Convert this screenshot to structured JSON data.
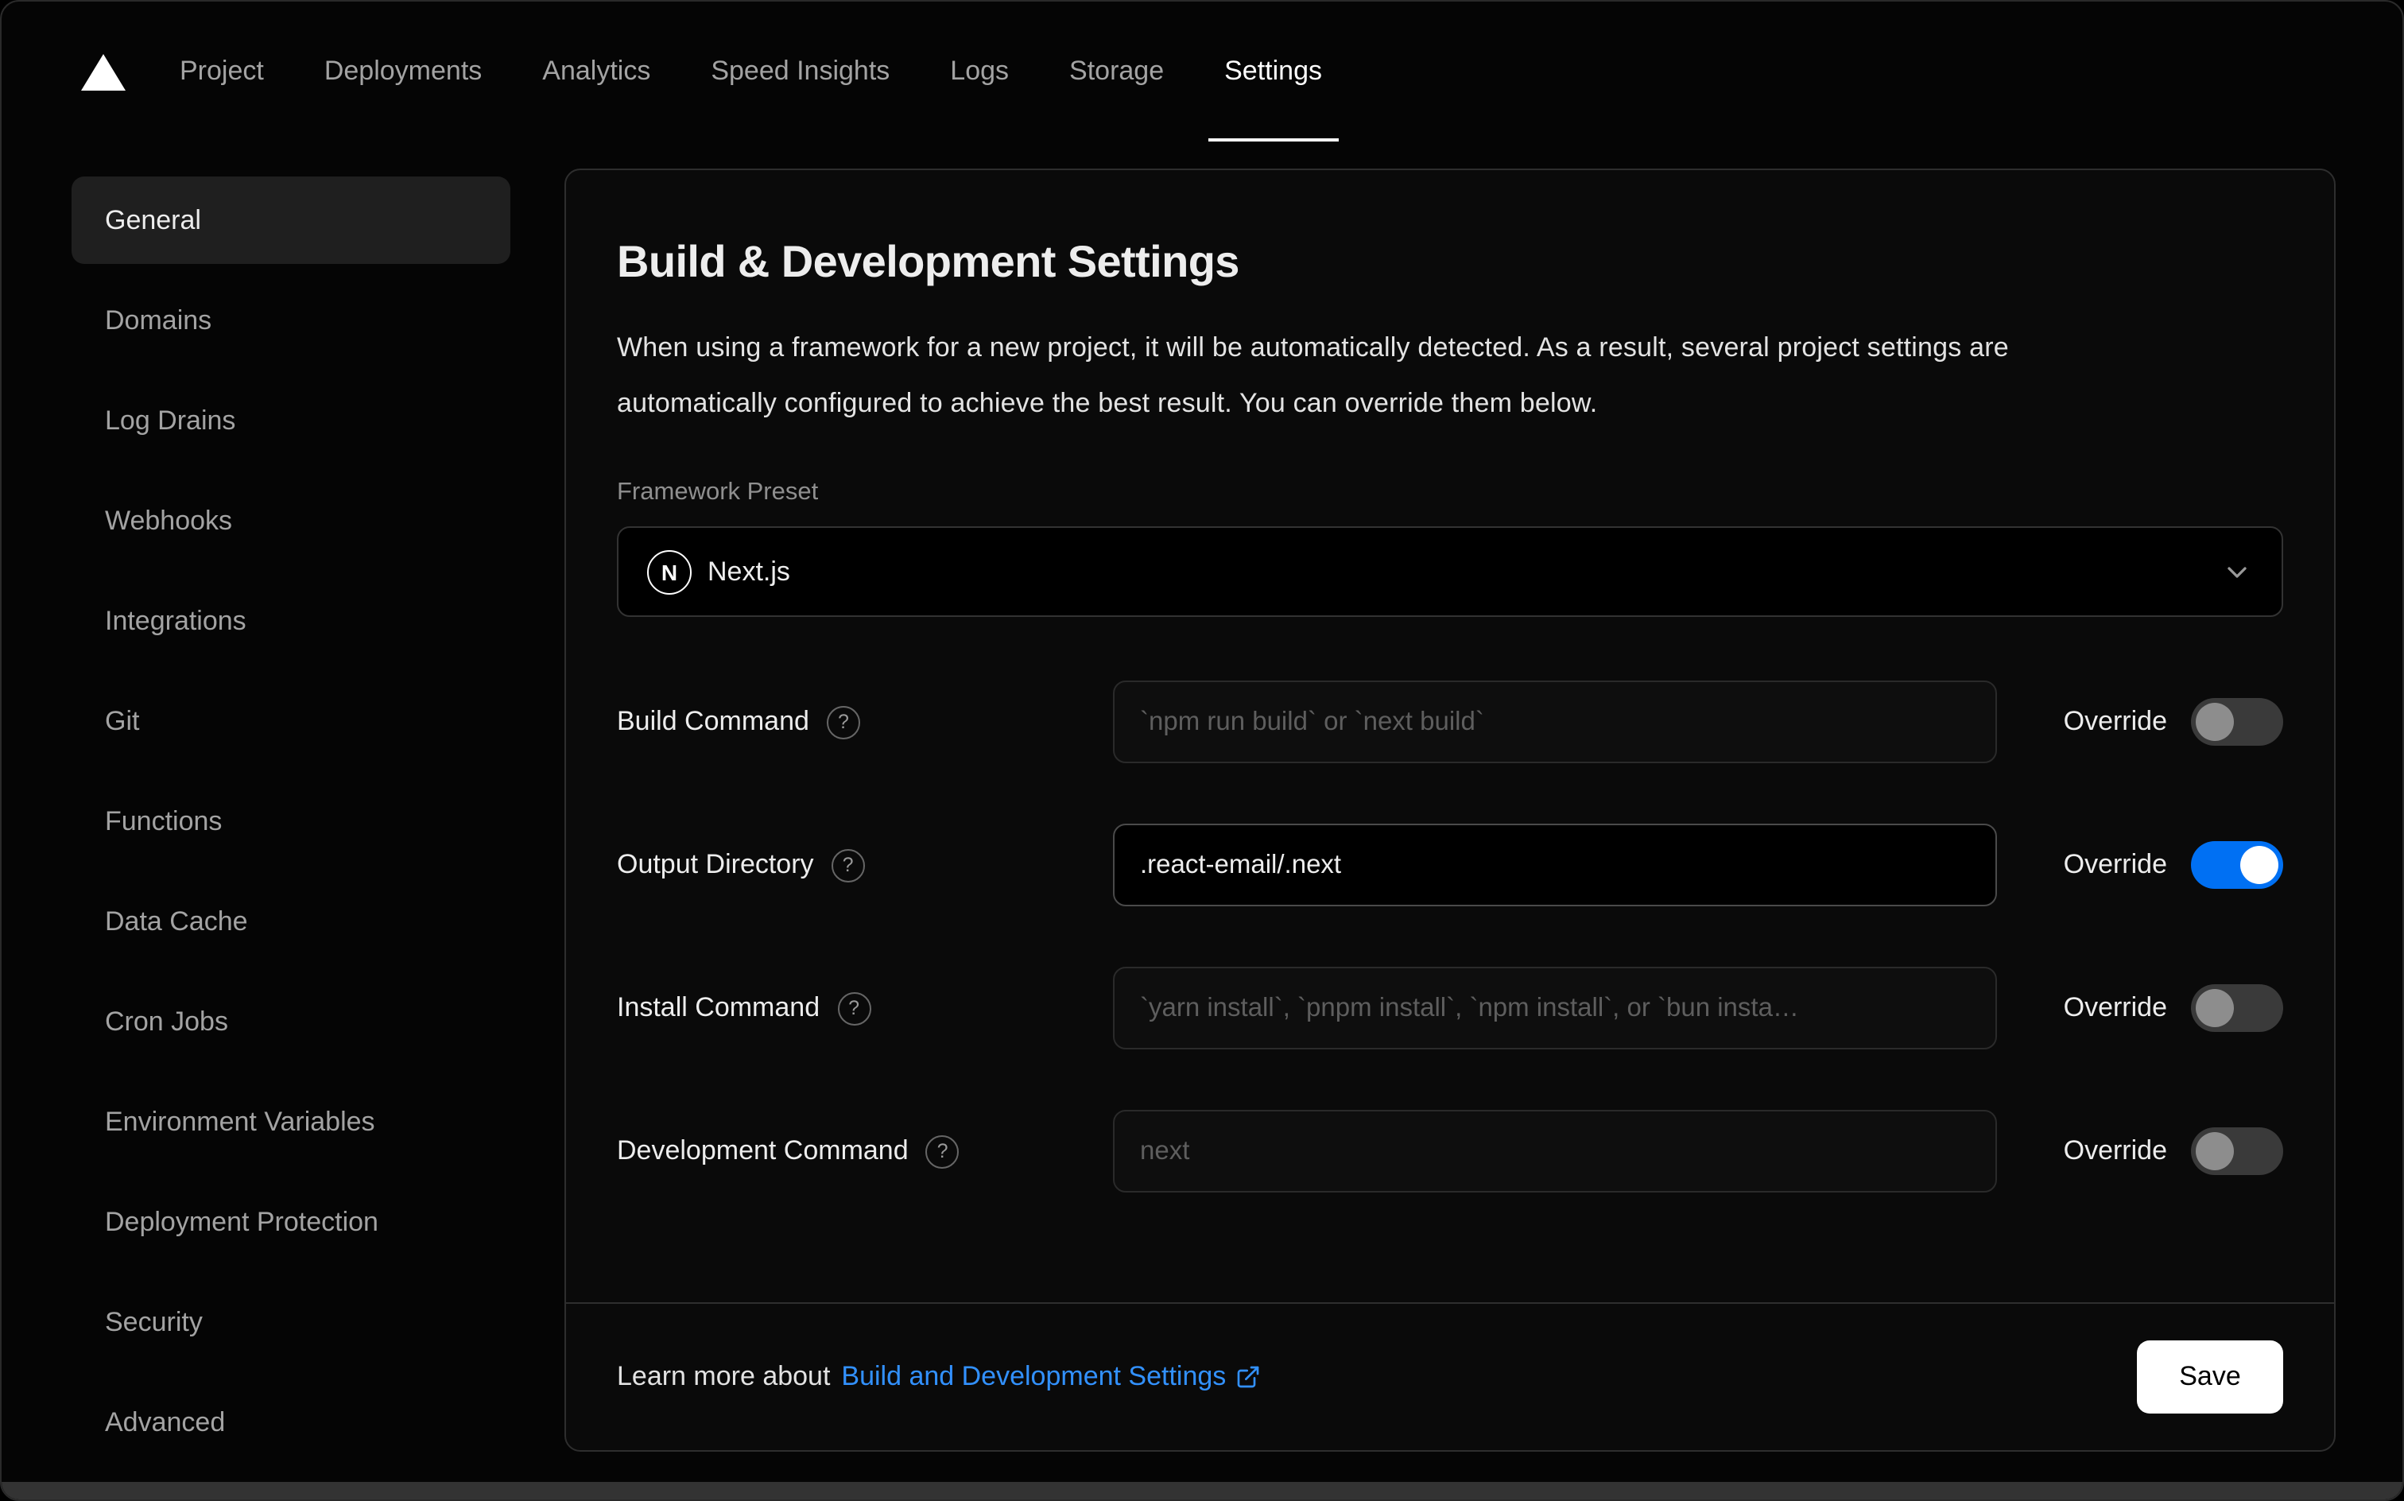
{
  "nav": {
    "tabs": [
      {
        "label": "Project",
        "active": false
      },
      {
        "label": "Deployments",
        "active": false
      },
      {
        "label": "Analytics",
        "active": false
      },
      {
        "label": "Speed Insights",
        "active": false
      },
      {
        "label": "Logs",
        "active": false
      },
      {
        "label": "Storage",
        "active": false
      },
      {
        "label": "Settings",
        "active": true
      }
    ]
  },
  "sidebar": {
    "items": [
      {
        "label": "General",
        "active": true
      },
      {
        "label": "Domains",
        "active": false
      },
      {
        "label": "Log Drains",
        "active": false
      },
      {
        "label": "Webhooks",
        "active": false
      },
      {
        "label": "Integrations",
        "active": false
      },
      {
        "label": "Git",
        "active": false
      },
      {
        "label": "Functions",
        "active": false
      },
      {
        "label": "Data Cache",
        "active": false
      },
      {
        "label": "Cron Jobs",
        "active": false
      },
      {
        "label": "Environment Variables",
        "active": false
      },
      {
        "label": "Deployment Protection",
        "active": false
      },
      {
        "label": "Security",
        "active": false
      },
      {
        "label": "Advanced",
        "active": false
      }
    ]
  },
  "panel": {
    "title": "Build & Development Settings",
    "description": "When using a framework for a new project, it will be automatically detected. As a result, several project settings are automatically configured to achieve the best result. You can override them below.",
    "framework": {
      "label": "Framework Preset",
      "value": "Next.js"
    },
    "override_label": "Override",
    "fields": [
      {
        "label": "Build Command",
        "placeholder": "`npm run build` or `next build`",
        "value": "",
        "override": false
      },
      {
        "label": "Output Directory",
        "placeholder": "",
        "value": ".react-email/.next",
        "override": true
      },
      {
        "label": "Install Command",
        "placeholder": "`yarn install`, `pnpm install`, `npm install`, or `bun insta…",
        "value": "",
        "override": false
      },
      {
        "label": "Development Command",
        "placeholder": "next",
        "value": "",
        "override": false
      }
    ],
    "footer": {
      "text": "Learn more about",
      "link": "Build and Development Settings",
      "save": "Save"
    }
  },
  "icons": {
    "help": "?",
    "nextjs": "N"
  },
  "colors": {
    "link_blue": "#3291ff",
    "toggle_on_blue": "#0070f3",
    "save_button_bg": "#ffffff",
    "active_item_bg": "#1f1f1f",
    "card_bg": "#0a0a0a"
  }
}
